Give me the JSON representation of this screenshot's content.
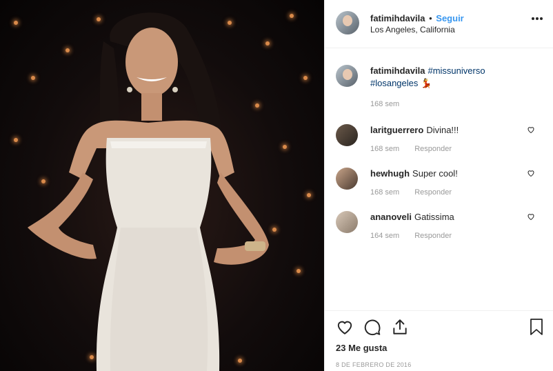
{
  "header": {
    "username": "fatimihdavila",
    "dot": "•",
    "follow_label": "Seguir",
    "location": "Los Angeles, California",
    "more_label": "•••"
  },
  "caption": {
    "username": "fatimihdavila",
    "hashtag1": "#missuniverso",
    "hashtag2": "#losangeles",
    "emoji": "💃",
    "time": "168 sem"
  },
  "comments": [
    {
      "username": "laritguerrero",
      "text": "Divina!!!",
      "time": "168 sem",
      "reply_label": "Responder"
    },
    {
      "username": "hewhugh",
      "text": "Super cool!",
      "time": "168 sem",
      "reply_label": "Responder"
    },
    {
      "username": "ananoveli",
      "text": "Gatissima",
      "time": "164 sem",
      "reply_label": "Responder"
    }
  ],
  "actions": {
    "likes": "23 Me gusta",
    "date": "8 DE FEBRERO DE 2016"
  },
  "icons": {
    "heart": "heart-icon",
    "comment": "comment-icon",
    "share": "share-icon",
    "bookmark": "bookmark-icon"
  },
  "colors": {
    "link": "#3897f0",
    "hashtag": "#003569",
    "muted": "#999999",
    "border": "#efefef"
  }
}
